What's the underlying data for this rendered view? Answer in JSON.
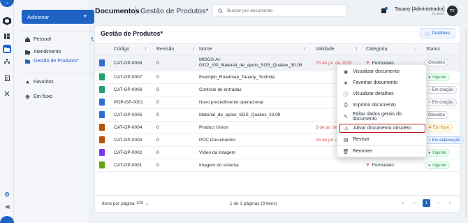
{
  "app": {
    "add_label": "Adicionar"
  },
  "sidebar": {
    "sections": [
      {
        "label": "Pessoal"
      },
      {
        "label": "Atendimento"
      },
      {
        "label": "Gestão de Produtos*"
      },
      {
        "label": "Favoritos"
      },
      {
        "label": "Em fluxo"
      }
    ]
  },
  "header": {
    "title": "Documentos",
    "subtitle": "Gestão de Produtos*",
    "search_placeholder": "Buscar por documento",
    "notification_count": "3",
    "user_name": "Tauany [Administrador]",
    "user_role": "PL ENG",
    "avatar_initials": "TY"
  },
  "panel": {
    "title": "Gestão de Produtos*",
    "details_label": "Detalhes",
    "columns": [
      "Código",
      "Revisão",
      "Nome",
      "Validade",
      "Categoria",
      "Status"
    ]
  },
  "rows": [
    {
      "icon_color": "#2f6fd3",
      "code": "CAT-GP-0008",
      "rev": "0",
      "name": "MtSOS-AI-0022_r00_Material_de_apoio_SOS_Qualiex_30.08",
      "name2": "",
      "validity": "23 de jul. de 2025",
      "category": "Formulário",
      "status": "Obsoleto",
      "status_style": "grey"
    },
    {
      "icon_color": "#22a06b",
      "code": "CAT-GP-0007",
      "rev": "0",
      "name": "Exemplo_Roadmap_Tauany_Yoshida",
      "validity": "",
      "category": "",
      "status": "Vigente",
      "status_style": "green"
    },
    {
      "icon_color": "#22a06b",
      "code": "CAT-GP-0006",
      "rev": "0",
      "name": "Controle de entradas",
      "validity": "",
      "category": "",
      "status": "Em criação",
      "status_style": "grey"
    },
    {
      "icon_color": "#2f6fd3",
      "code": "POP-GP-0001",
      "rev": "0",
      "name": "Novo procedimento operacional",
      "validity": "",
      "category": "",
      "status": "Em criação",
      "status_style": "grey"
    },
    {
      "icon_color": "#2f6fd3",
      "code": "CAT-GP-0005",
      "rev": "0",
      "name": "Material_de_apoio_SOS_Qualiex_23.08",
      "validity": "",
      "category": "",
      "status": "Obsoleto",
      "status_style": "grey"
    },
    {
      "icon_color": "#b45309",
      "code": "CAT-GP-0004",
      "rev": "0",
      "name": "Product Vision",
      "validity": "3 de jul. de",
      "category": "",
      "status": "Em fluxo",
      "status_style": "orange"
    },
    {
      "icon_color": "#b45309",
      "code": "CAT-GP-0003",
      "rev": "0",
      "name": "POC Documentos",
      "validity": "16 de jul. de",
      "category": "",
      "status": "Em elaboração",
      "status_style": "blue"
    },
    {
      "icon_color": "#7c3aed",
      "code": "CAT-GP-0002",
      "rev": "0",
      "name": "Vídeo da listagem",
      "validity": "",
      "category": "",
      "status": "Vigente",
      "status_style": "green"
    },
    {
      "icon_color": "#65a30d",
      "code": "CAT-GP-0001",
      "rev": "0",
      "name": "Imagem do sistema",
      "validity": "",
      "category": "Formulário",
      "status": "Vigente",
      "status_style": "green"
    }
  ],
  "footer": {
    "per_page_label": "Itens por página",
    "per_page_value": "100",
    "pages_info": "1 de 1 páginas (9 itens)",
    "current_page": "1"
  },
  "context_menu": {
    "items": [
      {
        "label": "Visualizar documento",
        "icon": "eye-icon"
      },
      {
        "label": "Favoritar documento",
        "icon": "star-icon"
      },
      {
        "label": "Visualizar detalhes",
        "icon": "info-icon"
      },
      {
        "label": "Imprimir documento",
        "icon": "print-icon"
      },
      {
        "label": "Editar dados gerais do documento",
        "icon": "pencil-icon"
      },
      {
        "label": "Ativar documento obsoleto",
        "icon": "warning-icon"
      },
      {
        "label": "Revisar",
        "icon": "review-icon"
      },
      {
        "label": "Remover",
        "icon": "trash-icon"
      }
    ]
  },
  "colors": {
    "accent": "#1e63c4",
    "danger_outline": "#b91c1c",
    "date_warning": "#d9534f"
  }
}
